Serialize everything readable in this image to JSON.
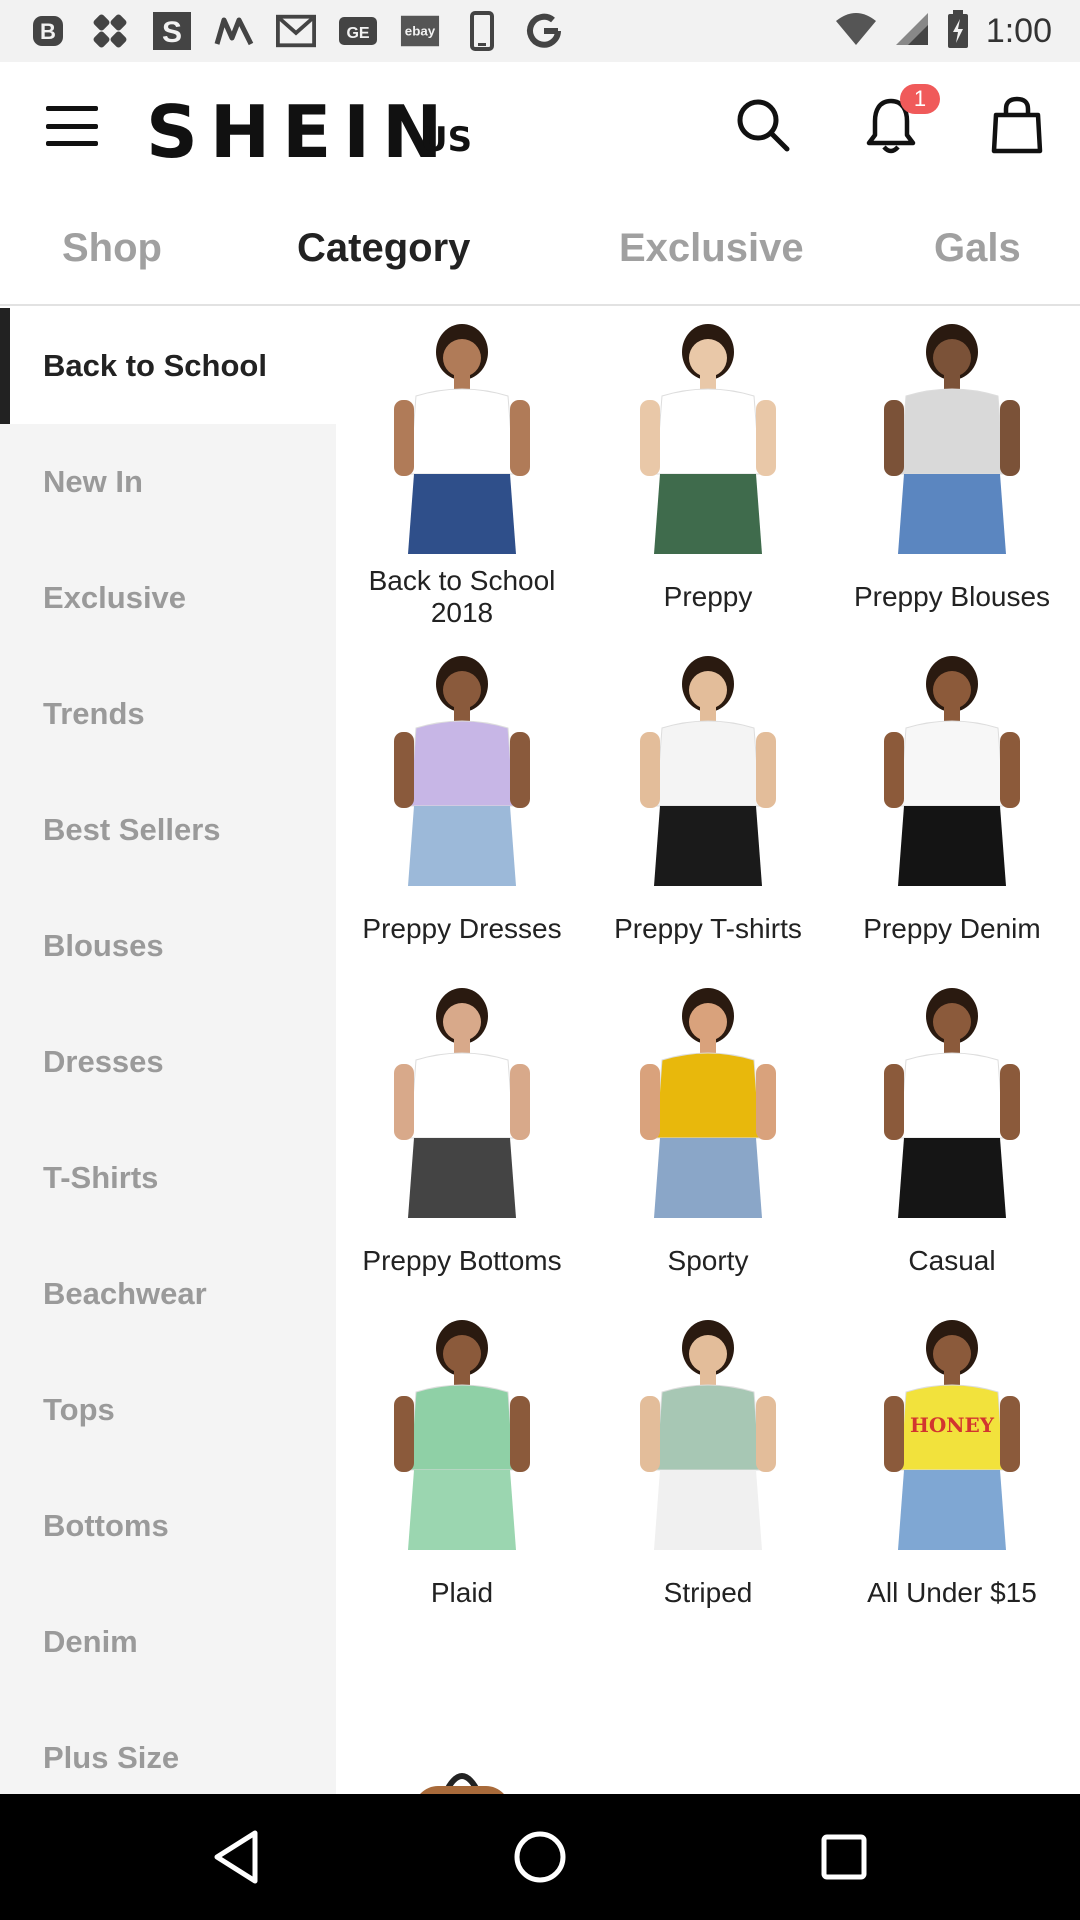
{
  "status_bar": {
    "time": "1:00",
    "icons": [
      "b-app-icon",
      "dropbox-icon",
      "s-app-icon",
      "m-app-icon",
      "gmail-icon",
      "ge-app-icon",
      "ebay-icon",
      "phone-icon",
      "google-icon"
    ],
    "ebay_label": "ebay",
    "ge_label": "GE"
  },
  "header": {
    "brand": "SHEIN",
    "region": "US",
    "notification_count": "1"
  },
  "tabs": [
    {
      "label": "Shop"
    },
    {
      "label": "Category"
    },
    {
      "label": "Exclusive"
    },
    {
      "label": "Gals"
    }
  ],
  "sidebar": {
    "items": [
      {
        "label": "Back to School"
      },
      {
        "label": "New In"
      },
      {
        "label": "Exclusive"
      },
      {
        "label": "Trends"
      },
      {
        "label": "Best Sellers"
      },
      {
        "label": "Blouses"
      },
      {
        "label": "Dresses"
      },
      {
        "label": "T-Shirts"
      },
      {
        "label": "Beachwear"
      },
      {
        "label": "Tops"
      },
      {
        "label": "Bottoms"
      },
      {
        "label": "Denim"
      },
      {
        "label": "Plus Size"
      }
    ]
  },
  "grid": {
    "items": [
      {
        "label": "Back to School 2018",
        "top": "#ffffff",
        "bottom": "#2f4f8a",
        "skin": "#b07b58"
      },
      {
        "label": "Preppy",
        "top": "#ffffff",
        "bottom": "#3f6b4c",
        "skin": "#e9c8a8"
      },
      {
        "label": "Preppy Blouses",
        "top": "#d9d9d9",
        "bottom": "#5b86c0",
        "skin": "#7b5238"
      },
      {
        "label": "Preppy Dresses",
        "top": "#c7b6e6",
        "bottom": "#9cb9d9",
        "skin": "#8a5a3c"
      },
      {
        "label": "Preppy T-shirts",
        "top": "#f4f4f4",
        "bottom": "#1a1a1a",
        "skin": "#e3bd9a"
      },
      {
        "label": "Preppy Denim",
        "top": "#f7f7f7",
        "bottom": "#141414",
        "skin": "#8c5a3a"
      },
      {
        "label": "Preppy Bottoms",
        "top": "#ffffff",
        "bottom": "#444444",
        "skin": "#d8a98a"
      },
      {
        "label": "Sporty",
        "top": "#e8b80c",
        "bottom": "#8aa6c8",
        "skin": "#d9a27c"
      },
      {
        "label": "Casual",
        "top": "#ffffff",
        "bottom": "#151515",
        "skin": "#8b5a3b"
      },
      {
        "label": "Plaid",
        "top": "#8fd0a6",
        "bottom": "#9bd6b0",
        "skin": "#8b5a3b"
      },
      {
        "label": "Striped",
        "top": "#a7c7b4",
        "bottom": "#f0f0f0",
        "skin": "#e3bd9a"
      },
      {
        "label": "All Under $15",
        "top": "#f2e23c",
        "bottom": "#7fa7d3",
        "skin": "#8b5a3b",
        "print": "HONEY"
      },
      {
        "label": "",
        "kind": "backpack",
        "color": "#a86a3a"
      },
      {
        "label": "",
        "kind": "sneakers",
        "color": "#f5f5f5"
      },
      {
        "label": "",
        "kind": "pouch",
        "color": "#ef9db6"
      }
    ]
  }
}
